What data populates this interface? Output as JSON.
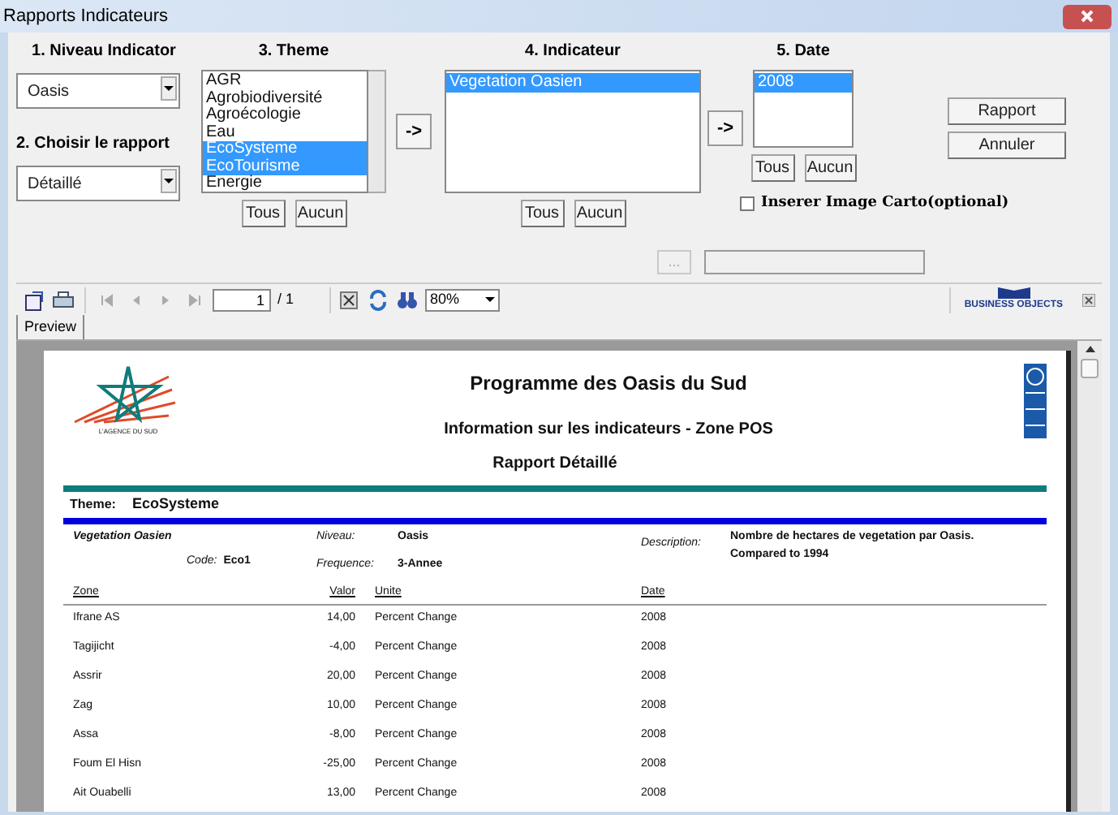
{
  "window": {
    "title": "Rapports Indicateurs"
  },
  "niveau": {
    "label": "1. Niveau Indicator",
    "value": "Oasis"
  },
  "rapport": {
    "label": "2. Choisir le rapport",
    "value": "Détaillé"
  },
  "theme": {
    "label": "3.  Theme",
    "items": [
      {
        "label": "AGR",
        "selected": false
      },
      {
        "label": "Agrobiodiversité",
        "selected": false
      },
      {
        "label": "Agroécologie",
        "selected": false
      },
      {
        "label": "Eau",
        "selected": false
      },
      {
        "label": "EcoSysteme",
        "selected": true
      },
      {
        "label": "EcoTourisme",
        "selected": true
      },
      {
        "label": "Energie",
        "selected": false
      }
    ],
    "buttons": [
      "Tous",
      "Aucun"
    ]
  },
  "transfer_button": "->",
  "indicateur": {
    "label": "4. Indicateur",
    "items": [
      {
        "label": "Vegetation Oasien",
        "selected": true
      }
    ],
    "buttons": [
      "Tous",
      "Aucun"
    ]
  },
  "transfer_button_2": "->",
  "date": {
    "label": "5. Date",
    "items": [
      {
        "label": "2008",
        "selected": true
      }
    ],
    "buttons": [
      "Tous",
      "Aucun"
    ]
  },
  "actions": [
    "Rapport",
    "Annuler"
  ],
  "carto": {
    "label": "Inserer Image Carto(optional)",
    "checked": false,
    "browse": "..."
  },
  "viewer": {
    "page": "1",
    "total": "/ 1",
    "zoom": "80%",
    "brand": "BUSINESS OBJECTS",
    "tabs": [
      {
        "label": "Preview",
        "selected": true
      }
    ]
  },
  "report": {
    "logo_caption": "L'AGENCE DU SUD",
    "title": "Programme des Oasis du Sud",
    "subtitle": "Information sur les indicateurs - Zone POS",
    "report_title": "Rapport Détaillé",
    "theme_label": "Theme:",
    "theme_value": "EcoSysteme",
    "indicator": {
      "name": "Vegetation Oasien",
      "code_label": "Code:",
      "code": "Eco1",
      "niveau_label": "Niveau:",
      "niveau": "Oasis",
      "frequence_label": "Frequence:",
      "frequence": "3-Annee",
      "description_label": "Description:",
      "description": "Nombre de hectares de vegetation par Oasis. Compared to 1994"
    },
    "columns": [
      "Zone",
      "Valor",
      "Unite",
      "Date"
    ],
    "rows": [
      [
        "Ifrane AS",
        "14,00",
        "Percent Change",
        "2008"
      ],
      [
        "Tagijicht",
        "-4,00",
        "Percent Change",
        "2008"
      ],
      [
        "Assrir",
        "20,00",
        "Percent Change",
        "2008"
      ],
      [
        "Zag",
        "10,00",
        "Percent Change",
        "2008"
      ],
      [
        "Assa",
        "-8,00",
        "Percent Change",
        "2008"
      ],
      [
        "Foum El Hisn",
        "-25,00",
        "Percent Change",
        "2008"
      ],
      [
        "Ait Ouabelli",
        "13,00",
        "Percent Change",
        "2008"
      ]
    ]
  }
}
